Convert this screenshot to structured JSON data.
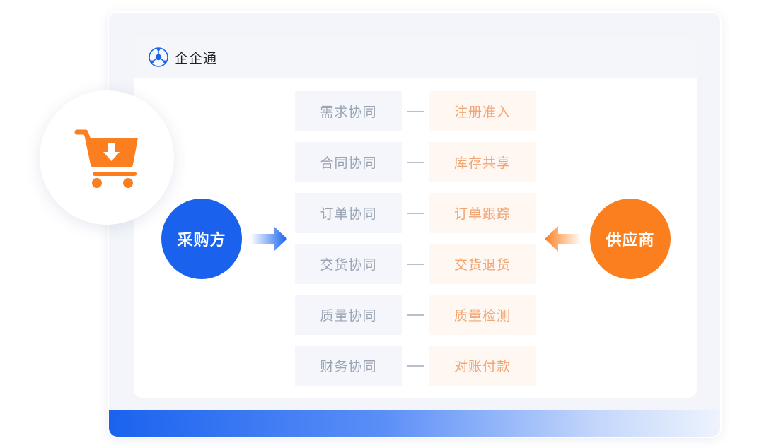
{
  "header": {
    "app_title": "企企通",
    "logo_icon": "compass-network-icon"
  },
  "cart": {
    "icon": "shopping-cart-download-icon",
    "color": "#fc7f1f"
  },
  "buyer": {
    "label": "采购方",
    "color": "#1a62ee"
  },
  "supplier": {
    "label": "供应商",
    "color": "#fc7f1f"
  },
  "rows": [
    {
      "buyer_side": "需求协同",
      "supplier_side": "注册准入"
    },
    {
      "buyer_side": "合同协同",
      "supplier_side": "库存共享"
    },
    {
      "buyer_side": "订单协同",
      "supplier_side": "订单跟踪"
    },
    {
      "buyer_side": "交货协同",
      "supplier_side": "交货退货"
    },
    {
      "buyer_side": "质量协同",
      "supplier_side": "质量检测"
    },
    {
      "buyer_side": "财务协同",
      "supplier_side": "对账付款"
    }
  ]
}
